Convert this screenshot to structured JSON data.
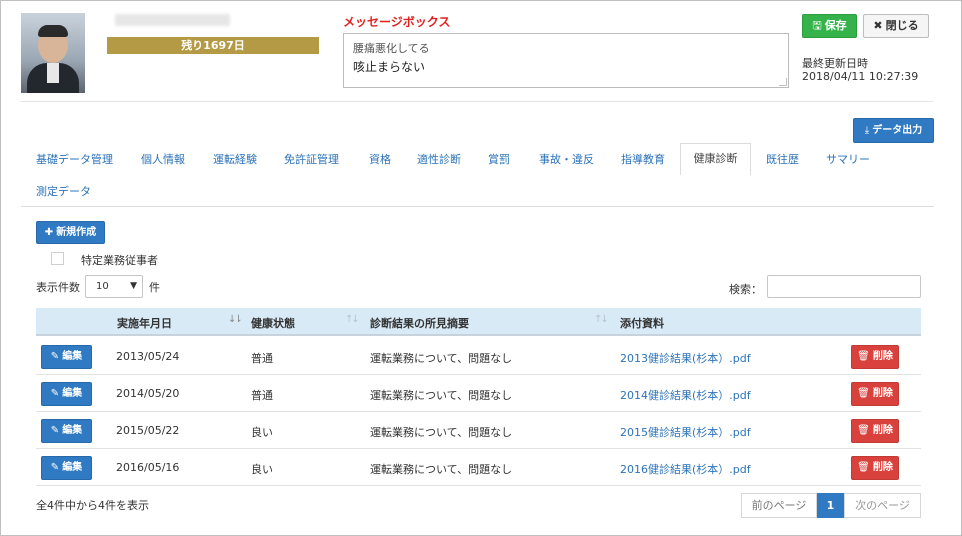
{
  "header": {
    "remaining": "残り1697日",
    "message_label": "メッセージボックス",
    "message_lines": [
      "腰痛悪化してる",
      "咳止まらない"
    ],
    "save_label": "保存",
    "close_label": "閉じる",
    "updated_label": "最終更新日時",
    "updated_value": "2018/04/11 10:27:39",
    "export_label": "データ出力"
  },
  "tabs": [
    {
      "label": "基礎データ管理"
    },
    {
      "label": "個人情報"
    },
    {
      "label": "運転経験"
    },
    {
      "label": "免許証管理"
    },
    {
      "label": "資格"
    },
    {
      "label": "適性診断"
    },
    {
      "label": "賞罰"
    },
    {
      "label": "事故・違反"
    },
    {
      "label": "指導教育"
    },
    {
      "label": "健康診断",
      "active": true
    },
    {
      "label": "既往歴"
    },
    {
      "label": "サマリー"
    },
    {
      "label": "測定データ"
    }
  ],
  "panel": {
    "new_label": "新規作成",
    "checkbox_label": "特定業務従事者",
    "length_label": "表示件数",
    "length_value": "10",
    "length_suffix": "件",
    "search_label": "検索："
  },
  "table": {
    "columns": [
      "実施年月日",
      "健康状態",
      "診断結果の所見摘要",
      "添付資料"
    ],
    "edit_label": "編集",
    "delete_label": "削除",
    "rows": [
      {
        "date": "2013/05/24",
        "status": "普通",
        "summary": "運転業務について、問題なし",
        "file": "2013健診結果(杉本）.pdf"
      },
      {
        "date": "2014/05/20",
        "status": "普通",
        "summary": "運転業務について、問題なし",
        "file": "2014健診結果(杉本）.pdf"
      },
      {
        "date": "2015/05/22",
        "status": "良い",
        "summary": "運転業務について、問題なし",
        "file": "2015健診結果(杉本）.pdf"
      },
      {
        "date": "2016/05/16",
        "status": "良い",
        "summary": "運転業務について、問題なし",
        "file": "2016健診結果(杉本）.pdf"
      }
    ]
  },
  "footer": {
    "info": "全4件中から4件を表示",
    "prev_label": "前のページ",
    "page": "1",
    "next_label": "次のページ"
  },
  "colors": {
    "primary": "#2f7ac2",
    "success": "#35b34a",
    "danger": "#d9413c",
    "gold": "#b59a46",
    "message_label": "#e0211f",
    "table_header": "#d9eaf7"
  },
  "icons": {
    "save": "floppy-icon",
    "close": "close-icon",
    "export": "download-icon",
    "new": "plus-icon",
    "edit": "edit-icon",
    "delete": "trash-icon"
  }
}
